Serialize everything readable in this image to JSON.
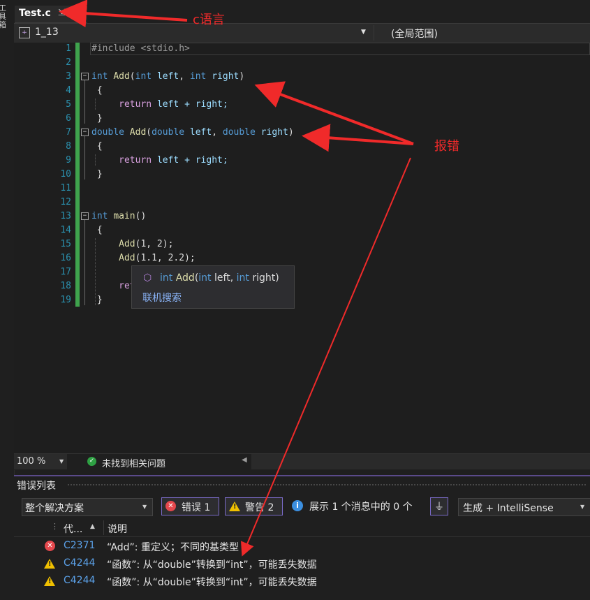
{
  "toolbox": {
    "label": "工具箱"
  },
  "tab": {
    "title": "Test.c",
    "pin_icon": "pin-icon",
    "close_icon": "close-icon"
  },
  "navbar": {
    "project": "1_13",
    "scope": "(全局范围)"
  },
  "editor": {
    "line_numbers": [
      "1",
      "2",
      "3",
      "4",
      "5",
      "6",
      "7",
      "8",
      "9",
      "10",
      "11",
      "12",
      "13",
      "14",
      "15",
      "16",
      "17",
      "18",
      "19"
    ],
    "lines": {
      "l1": "#include <stdio.h>",
      "l3_kw": "int",
      "l3_fn": "Add",
      "l3_open": "(",
      "l3_kw2": "int",
      "l3_p1": "left",
      "l3_comma": ",",
      "l3_kw3": "int",
      "l3_p2": "right",
      "l3_close": ")",
      "l4": "{",
      "l5_ret": "return",
      "l5_rest": "left + right;",
      "l6": "}",
      "l7_kw": "double",
      "l7_fn": "Add",
      "l7_open": "(",
      "l7_kw2": "double",
      "l7_p1": "left",
      "l7_comma": ",",
      "l7_kw3": "double",
      "l7_p2": "right",
      "l7_close": ")",
      "l8": "{",
      "l9_ret": "return",
      "l9_rest": "left + right;",
      "l10": "}",
      "l13_kw": "int",
      "l13_fn": "main",
      "l13_rest": "()",
      "l14": "{",
      "l15_fn": "Add",
      "l15_rest": "(1, 2);",
      "l16_fn": "Add",
      "l16_rest": "(1.1, 2.2);",
      "l18_ret": "retu",
      "l19": "}"
    }
  },
  "tooltip": {
    "kw1": "int",
    "fn": "Add",
    "open": "(",
    "kw2": "int",
    "p1": "left, ",
    "kw3": "int",
    "p2": "right",
    "close": ")",
    "link": "联机搜索"
  },
  "statusbar": {
    "zoom": "100 %",
    "status": "未找到相关问题"
  },
  "error_list": {
    "title": "错误列表",
    "scope": "整个解决方案",
    "errors_label": "错误 1",
    "warnings_label": "警告 2",
    "messages_label": "展示 1 个消息中的 0 个",
    "build_filter": "生成 + IntelliSense",
    "columns": {
      "code": "代...",
      "description": "说明"
    },
    "rows": [
      {
        "severity": "error",
        "code": "C2371",
        "description": "“Add”: 重定义；不同的基类型"
      },
      {
        "severity": "warning",
        "code": "C4244",
        "description": "“函数”: 从“double”转换到“int”，可能丢失数据"
      },
      {
        "severity": "warning",
        "code": "C4244",
        "description": "“函数”: 从“double”转换到“int”，可能丢失数据"
      }
    ]
  },
  "annotations": {
    "c_language": "c语言",
    "error": "报错"
  },
  "colors": {
    "annotation": "#f02a2a",
    "change_bar": "#3fa34d",
    "keyword": "#569cd6",
    "function": "#dcdcaa",
    "error": "#e5484d",
    "warning": "#f0c000"
  }
}
